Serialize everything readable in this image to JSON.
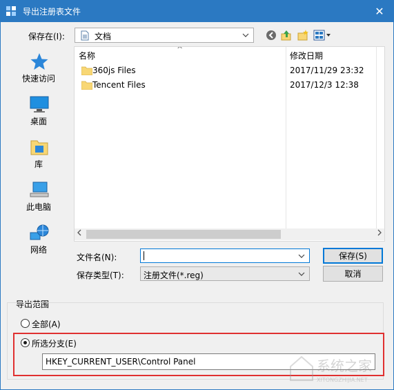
{
  "window": {
    "title": "导出注册表文件",
    "close_glyph": "✕"
  },
  "save_in": {
    "label": "保存在(I):",
    "value": "文档"
  },
  "places": [
    {
      "label": "快速访问"
    },
    {
      "label": "桌面"
    },
    {
      "label": "库"
    },
    {
      "label": "此电脑"
    },
    {
      "label": "网络"
    }
  ],
  "file_list": {
    "columns": [
      "名称",
      "修改日期"
    ],
    "sort_glyph": "^",
    "rows": [
      {
        "name": "360js Files",
        "date": "2017/11/29 23:32"
      },
      {
        "name": "Tencent Files",
        "date": "2017/12/3 12:38"
      }
    ]
  },
  "filename": {
    "label": "文件名(N):",
    "value": ""
  },
  "filetype": {
    "label": "保存类型(T):",
    "value": "注册文件(*.reg)"
  },
  "buttons": {
    "save": "保存(S)",
    "cancel": "取消"
  },
  "export_range": {
    "title": "导出范围",
    "all_label": "全部(A)",
    "branch_label": "所选分支(E)",
    "branch_value": "HKEY_CURRENT_USER\\Control Panel",
    "selected": "branch"
  },
  "watermark": {
    "text": "系统之家",
    "sub": "XITONGZHIJIA.NET"
  },
  "colors": {
    "titlebar": "#2b79c2",
    "highlight_box": "#e03030",
    "folder": "#f8d775"
  }
}
